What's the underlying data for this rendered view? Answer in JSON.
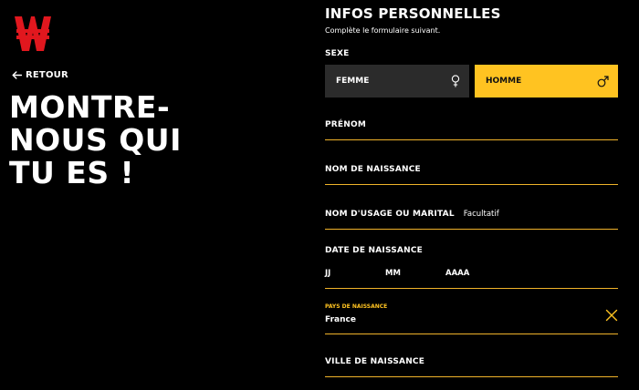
{
  "brand": {
    "accent": "#ffc321",
    "logo": "winamax-w-logo",
    "logo_color": "#e1171e"
  },
  "nav": {
    "back_label": "RETOUR"
  },
  "hero": {
    "title": "MONTRE-\nNOUS QUI\nTU ES !"
  },
  "form": {
    "title": "INFOS PERSONNELLES",
    "subtitle": "Complète le formulaire suivant.",
    "sexe": {
      "label": "SEXE",
      "options": [
        {
          "label": "FEMME",
          "icon": "female-icon",
          "selected": false
        },
        {
          "label": "HOMME",
          "icon": "male-icon",
          "selected": true
        }
      ]
    },
    "prenom": {
      "label": "PRÉNOM"
    },
    "nom_naissance": {
      "label": "NOM DE NAISSANCE"
    },
    "nom_usage": {
      "label": "NOM D'USAGE OU MARITAL",
      "hint": "Facultatif"
    },
    "date_naissance": {
      "label": "DATE DE NAISSANCE",
      "day": "JJ",
      "month": "MM",
      "year": "AAAA"
    },
    "pays_naissance": {
      "label": "PAYS DE NAISSANCE",
      "value": "France",
      "clear_icon": "close-icon"
    },
    "ville_naissance": {
      "label": "VILLE DE NAISSANCE"
    }
  }
}
